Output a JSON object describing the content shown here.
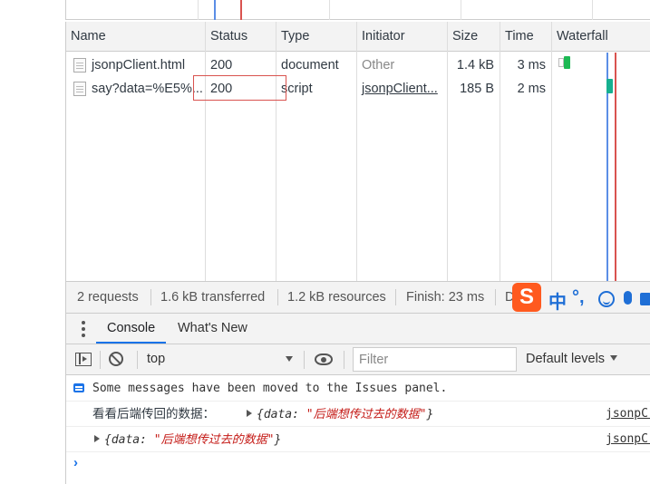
{
  "network": {
    "columns": [
      "Name",
      "Status",
      "Type",
      "Initiator",
      "Size",
      "Time",
      "Waterfall"
    ],
    "rows": [
      {
        "name": "jsonpClient.html",
        "status": "200",
        "type": "document",
        "initiator": "Other",
        "size": "1.4 kB",
        "time": "3 ms"
      },
      {
        "name": "say?data=%E5%...",
        "status": "200",
        "type": "script",
        "initiator": "jsonpClient...",
        "size": "185 B",
        "time": "2 ms"
      }
    ]
  },
  "summary": {
    "requests": "2 requests",
    "transferred": "1.6 kB transferred",
    "resources": "1.2 kB resources",
    "finish": "Finish: 23 ms",
    "dom": "D"
  },
  "ime": {
    "logo": "S",
    "lang": "中",
    "punct": "°,"
  },
  "drawer": {
    "tabs": [
      "Console",
      "What's New"
    ]
  },
  "console_toolbar": {
    "context": "top",
    "filter_placeholder": "Filter",
    "levels": "Default levels"
  },
  "console": {
    "info_message": "Some messages have been moved to the Issues panel.",
    "log1_label": "看看后端传回的数据：",
    "obj_prefix": "{data: ",
    "obj_value": "\"后端想传过去的数据\"",
    "obj_suffix": "}",
    "source": "jsonpC..."
  },
  "colors": {
    "accent": "#1a73e8",
    "load_line": "#d9534f",
    "dom_line": "#5b8ee6",
    "ime": "#ff5a1f"
  }
}
